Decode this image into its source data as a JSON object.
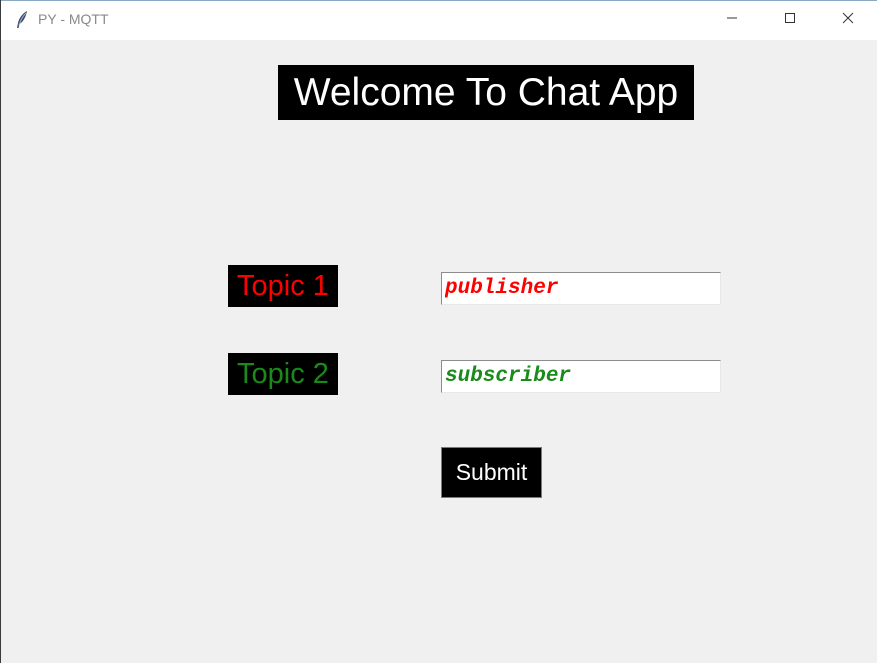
{
  "window": {
    "title": "PY - MQTT",
    "icons": {
      "app": "feather-icon",
      "minimize": "minimize-icon",
      "maximize": "maximize-icon",
      "close": "close-icon"
    }
  },
  "main": {
    "heading": "Welcome To Chat App",
    "topic1": {
      "label": "Topic 1",
      "value": "publisher",
      "color": "#ff0000"
    },
    "topic2": {
      "label": "Topic 2",
      "value": "subscriber",
      "color": "#1a8a1a"
    },
    "submit_label": "Submit"
  }
}
